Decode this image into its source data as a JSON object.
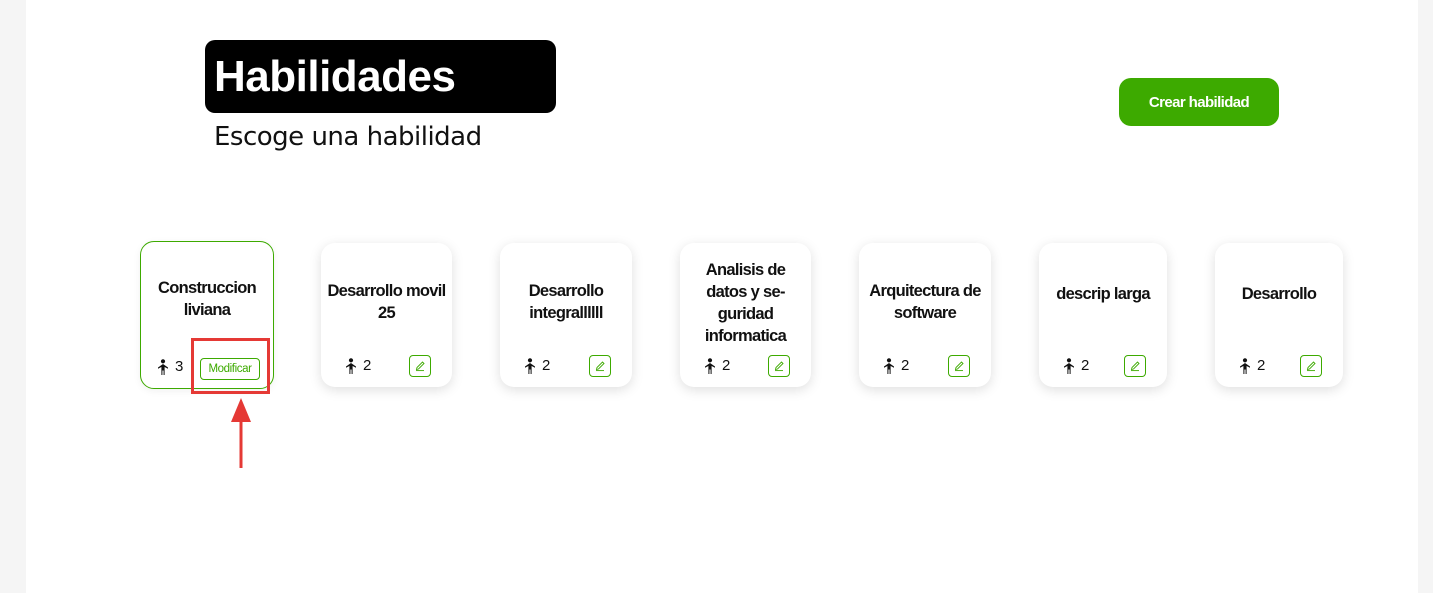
{
  "header": {
    "title": "Habilidades",
    "subtitle": "Escoge una habilidad",
    "create_button": "Crear habilidad"
  },
  "skills": [
    {
      "name": "Construccion liviana",
      "count": "3",
      "action": "Modificar"
    },
    {
      "name": "Desarrollo movil 25",
      "count": "2"
    },
    {
      "name": "Desarrollo integrallllll",
      "count": "2"
    },
    {
      "name": "Analisis de datos y se-guridad informatica",
      "count": "2"
    },
    {
      "name": "Arquitectura de software",
      "count": "2"
    },
    {
      "name": "descrip larga",
      "count": "2"
    },
    {
      "name": "Desarrollo",
      "count": "2"
    }
  ],
  "icons": {
    "person": "person-icon",
    "edit": "pencil-icon",
    "annotation_arrow": "arrow-up-icon"
  },
  "colors": {
    "accent": "#3daa00",
    "annotation": "#e53935",
    "title_bg": "#000000"
  }
}
